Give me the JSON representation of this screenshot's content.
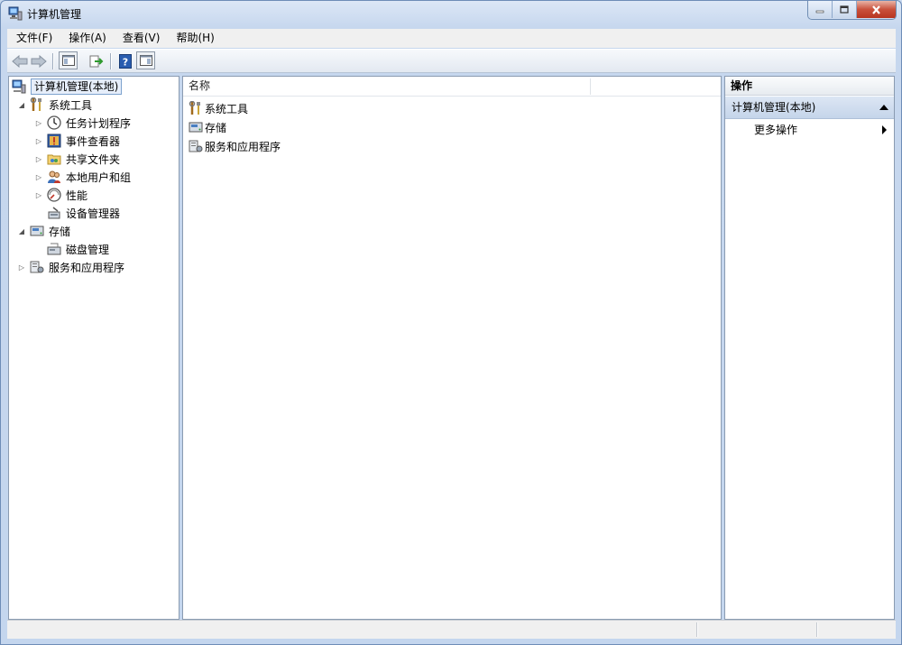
{
  "window": {
    "title": "计算机管理"
  },
  "menu": [
    {
      "label": "文件(F)"
    },
    {
      "label": "操作(A)"
    },
    {
      "label": "查看(V)"
    },
    {
      "label": "帮助(H)"
    }
  ],
  "tree": {
    "root": "计算机管理(本地)",
    "system_tools": {
      "label": "系统工具",
      "children": [
        "任务计划程序",
        "事件查看器",
        "共享文件夹",
        "本地用户和组",
        "性能",
        "设备管理器"
      ]
    },
    "storage": {
      "label": "存储",
      "children": [
        "磁盘管理"
      ]
    },
    "services": {
      "label": "服务和应用程序"
    }
  },
  "list": {
    "column_name": "名称",
    "rows": [
      "系统工具",
      "存储",
      "服务和应用程序"
    ]
  },
  "actions": {
    "header": "操作",
    "group": "计算机管理(本地)",
    "more": "更多操作"
  },
  "colors": {
    "accent": "#c5d5ea",
    "title_bg": "#dce7f6",
    "close": "#c9503b"
  }
}
